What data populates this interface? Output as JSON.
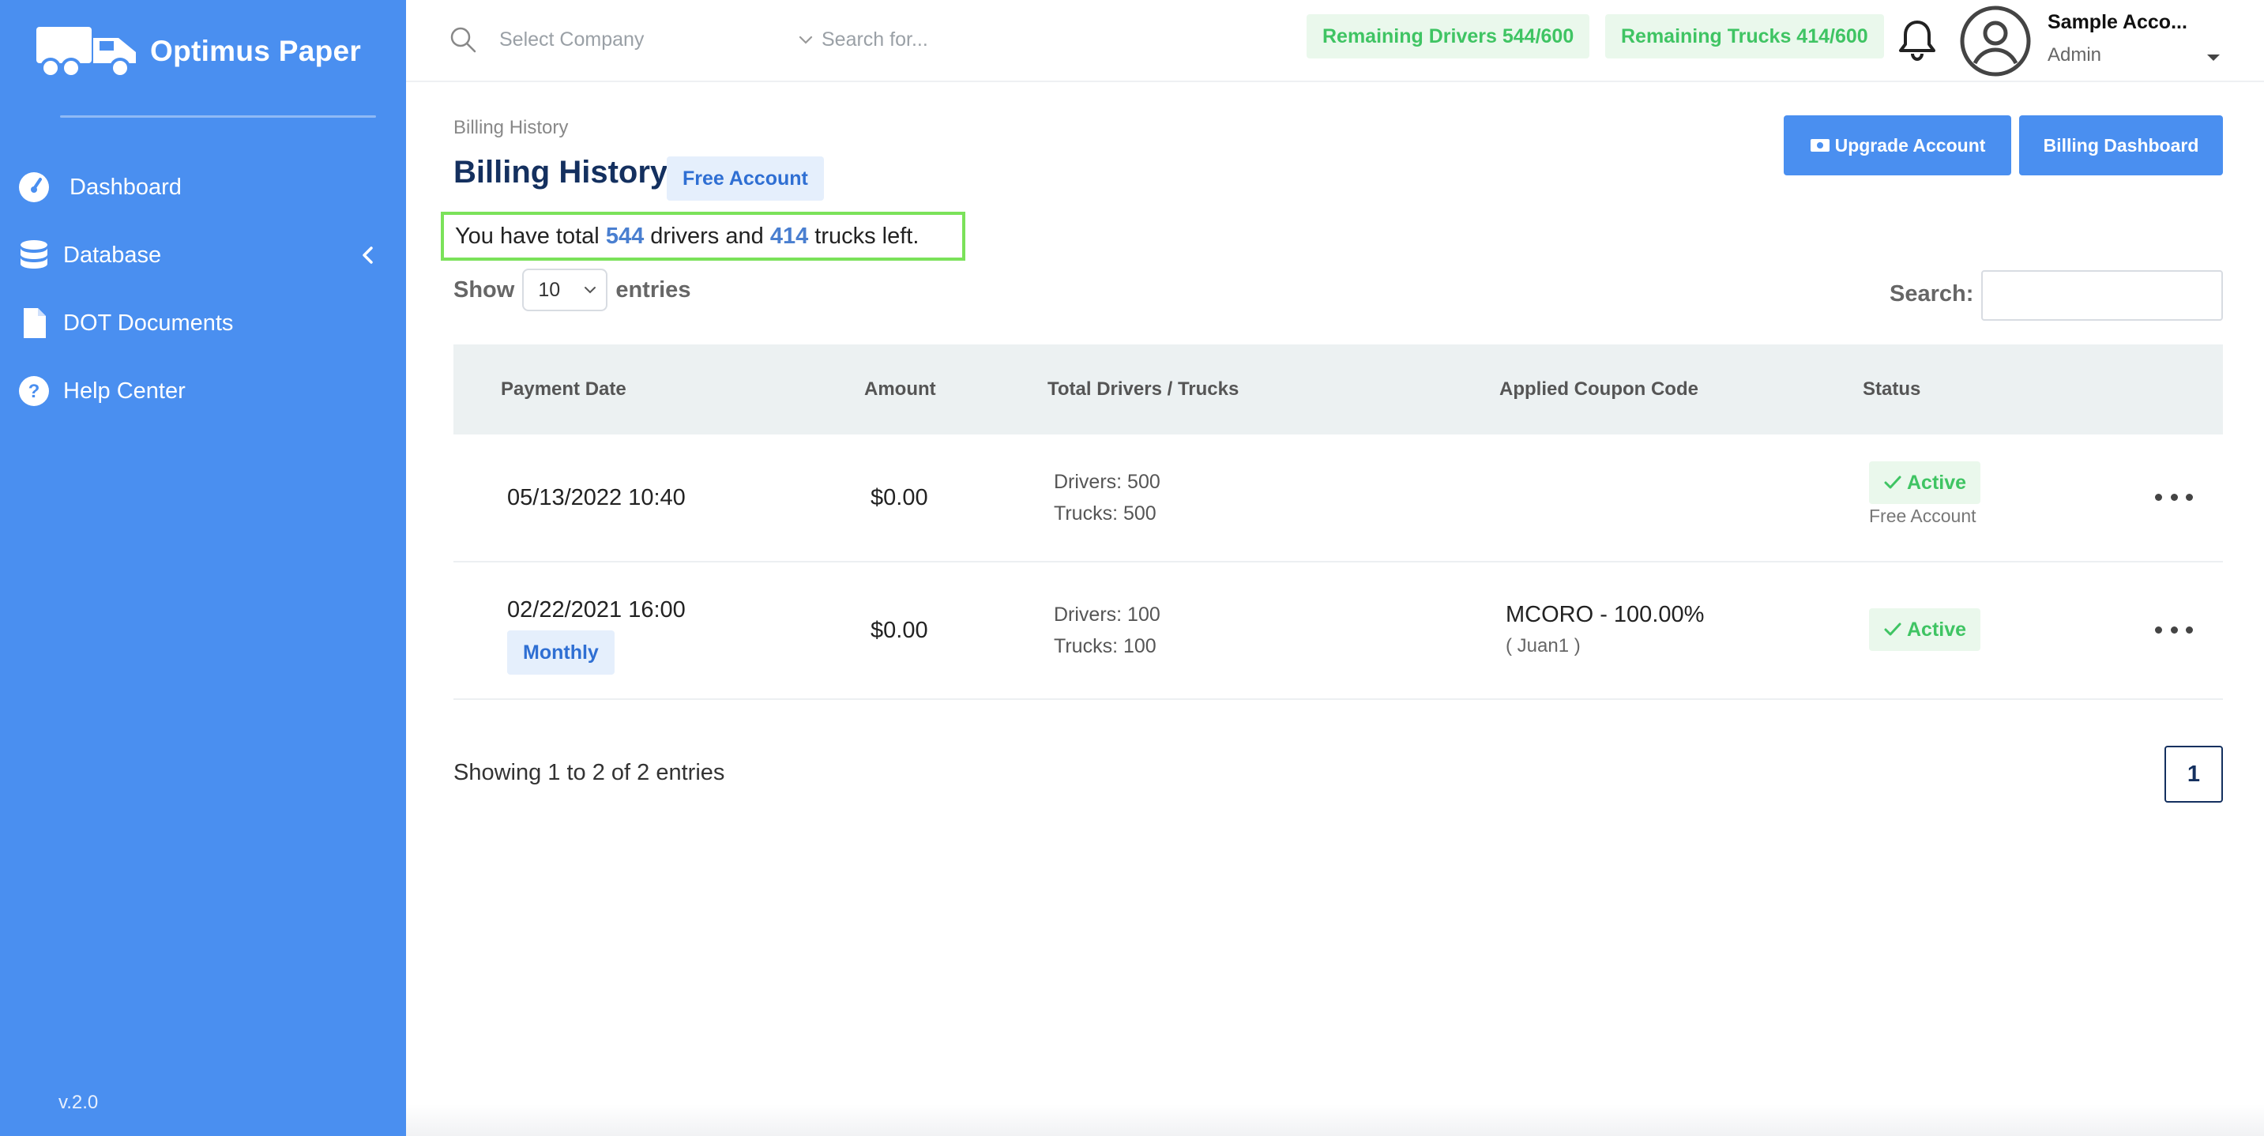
{
  "sidebar": {
    "brand": "Optimus Paper",
    "items": [
      {
        "label": "Dashboard",
        "icon": "dashboard-gauge-icon"
      },
      {
        "label": "Database",
        "icon": "database-icon"
      },
      {
        "label": "DOT Documents",
        "icon": "document-icon"
      },
      {
        "label": "Help Center",
        "icon": "help-circle-icon"
      }
    ],
    "version": "v.2.0"
  },
  "topbar": {
    "company_placeholder": "Select Company",
    "search_placeholder": "Search for...",
    "remaining_drivers": "Remaining Drivers 544/600",
    "remaining_trucks": "Remaining Trucks 414/600",
    "user_name": "Sample Acco...",
    "user_role": "Admin"
  },
  "page": {
    "breadcrumb": "Billing History",
    "title": "Billing History",
    "plan_badge": "Free Account",
    "upgrade_label": "Upgrade Account",
    "dashboard_label": "Billing Dashboard",
    "summary": {
      "prefix": "You have total",
      "drivers": "544",
      "middle": "drivers and",
      "trucks": "414",
      "suffix": "trucks left."
    }
  },
  "table": {
    "show_label": "Show",
    "entries_value": "10",
    "entries_label": "entries",
    "search_label": "Search:",
    "headers": [
      "Payment Date",
      "Amount",
      "Total Drivers / Trucks",
      "Applied Coupon Code",
      "Status"
    ],
    "rows": [
      {
        "date": "05/13/2022 10:40",
        "frequency": "",
        "amount": "$0.00",
        "drivers": "Drivers: 500",
        "trucks": "Trucks: 500",
        "coupon": "",
        "coupon_owner": "",
        "status": "Active",
        "status_note": "Free Account"
      },
      {
        "date": "02/22/2021 16:00",
        "frequency": "Monthly",
        "amount": "$0.00",
        "drivers": "Drivers: 100",
        "trucks": "Trucks: 100",
        "coupon": "MCORO - 100.00%",
        "coupon_owner": "( Juan1 )",
        "status": "Active",
        "status_note": ""
      }
    ],
    "showing": "Showing 1 to 2 of 2 entries",
    "current_page": "1"
  },
  "colors": {
    "sidebar": "#4a8ff0",
    "primary": "#4a8ff0",
    "title": "#14305f",
    "success": "#3fc463",
    "highlight_border": "#7be25a"
  }
}
